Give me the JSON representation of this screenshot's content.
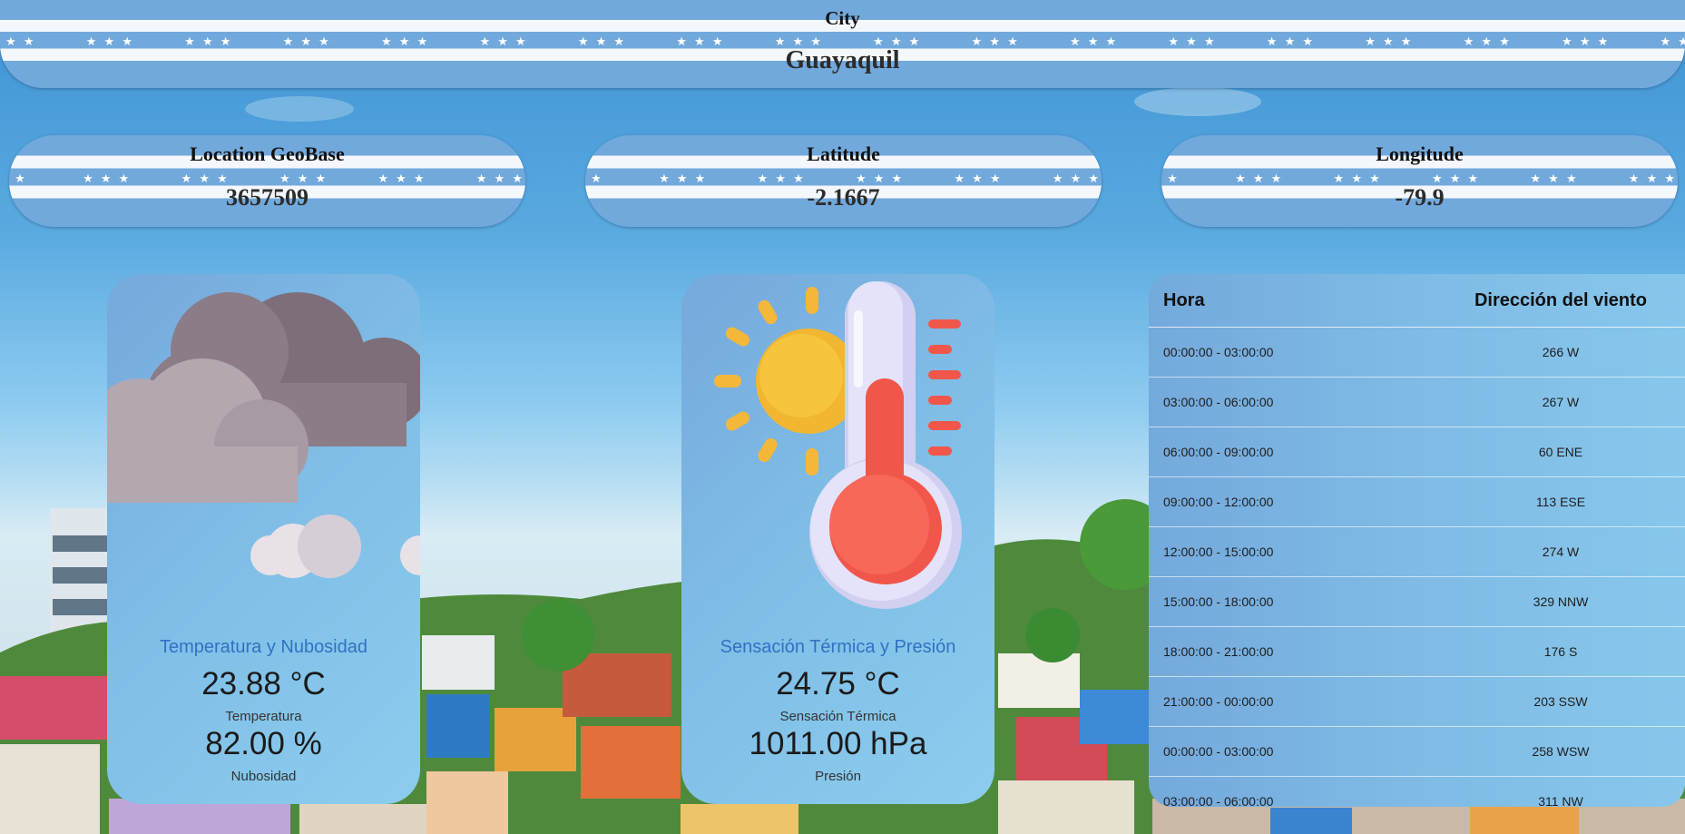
{
  "colors": {
    "banner_blue": "#72a9dc",
    "banner_white": "#f4f8fc",
    "card_title": "#2f72c4"
  },
  "city": {
    "label": "City",
    "value": "Guayaquil"
  },
  "geo": {
    "location": {
      "label": "Location GeoBase",
      "value": "3657509"
    },
    "latitude": {
      "label": "Latitude",
      "value": "-2.1667"
    },
    "longitude": {
      "label": "Longitude",
      "value": "-79.9"
    }
  },
  "temp_card": {
    "icon": "cloudy-icon",
    "title": "Temperatura y Nubosidad",
    "value1": "23.88 °C",
    "label1": "Temperatura",
    "value2": "82.00 %",
    "label2": "Nubosidad"
  },
  "feel_card": {
    "icon": "sun-thermometer-icon",
    "title": "Sensación Térmica y Presión",
    "value1": "24.75 °C",
    "label1": "Sensación Térmica",
    "value2": "1011.00 hPa",
    "label2": "Presión"
  },
  "wind_table": {
    "headers": [
      "Hora",
      "Dirección del viento"
    ],
    "rows": [
      [
        "00:00:00 - 03:00:00",
        "266 W"
      ],
      [
        "03:00:00 - 06:00:00",
        "267 W"
      ],
      [
        "06:00:00 - 09:00:00",
        "60 ENE"
      ],
      [
        "09:00:00 - 12:00:00",
        "113 ESE"
      ],
      [
        "12:00:00 - 15:00:00",
        "274 W"
      ],
      [
        "15:00:00 - 18:00:00",
        "329 NNW"
      ],
      [
        "18:00:00 - 21:00:00",
        "176 S"
      ],
      [
        "21:00:00 - 00:00:00",
        "203 SSW"
      ],
      [
        "00:00:00 - 03:00:00",
        "258 WSW"
      ],
      [
        "03:00:00 - 06:00:00",
        "311 NW"
      ]
    ]
  }
}
